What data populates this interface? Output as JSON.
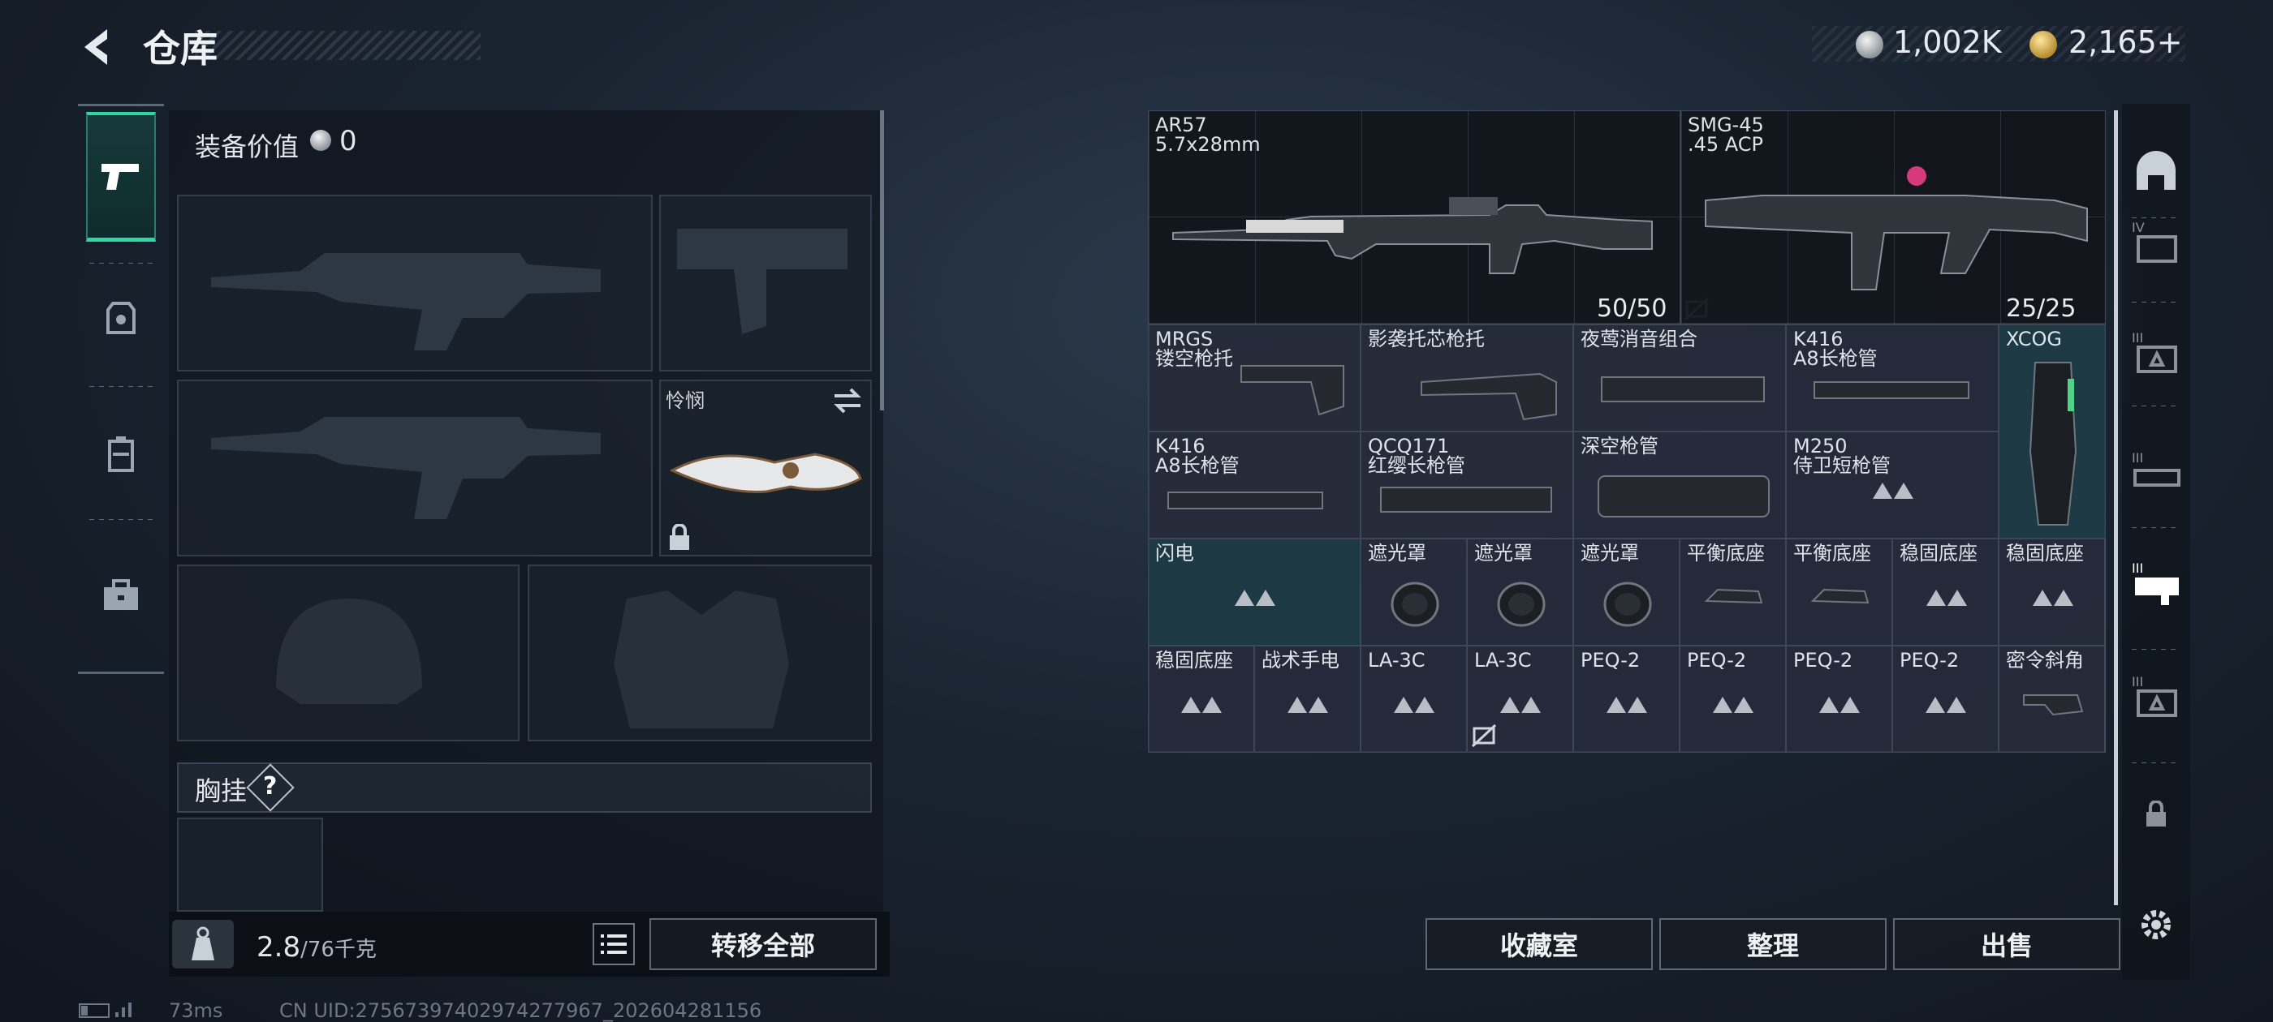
{
  "header": {
    "title": "仓库",
    "silver_amount": "1,002K",
    "gold_amount": "2,165+"
  },
  "left_nav": [
    {
      "icon": "pistol-icon",
      "active": true
    },
    {
      "icon": "armor-icon",
      "active": false
    },
    {
      "icon": "backpack-icon",
      "active": false
    },
    {
      "icon": "toolbox-icon",
      "active": false
    }
  ],
  "loadout": {
    "equipment_value_label": "装备价值",
    "equipment_value": "0",
    "melee_name": "怜悯",
    "chest_rig_label": "胸挂",
    "help_glyph": "?",
    "weight": "2.8",
    "weight_max": "/76千克",
    "transfer_all": "转移全部"
  },
  "inventory": {
    "guns": [
      {
        "name": "AR57",
        "ammo_type": "5.7x28mm",
        "ammo": "50/50"
      },
      {
        "name": "SMG-45",
        "ammo_type": ".45 ACP",
        "ammo": "25/25"
      }
    ],
    "row1": [
      {
        "name": "MRGS",
        "sub": "镂空枪托"
      },
      {
        "name": "影袭托芯枪托",
        "sub": ""
      },
      {
        "name": "夜莺消音组合",
        "sub": ""
      },
      {
        "name": "K416",
        "sub": "A8长枪管"
      }
    ],
    "xcog": "XCOG",
    "row2": [
      {
        "name": "K416",
        "sub": "A8长枪管"
      },
      {
        "name": "QCQ171",
        "sub": "红缨长枪管"
      },
      {
        "name": "深空枪管",
        "sub": ""
      },
      {
        "name": "M250",
        "sub": "侍卫短枪管"
      }
    ],
    "row3": [
      "闪电",
      "遮光罩",
      "遮光罩",
      "遮光罩",
      "平衡底座",
      "平衡底座",
      "稳固底座",
      "稳固底座"
    ],
    "row4": [
      "稳固底座",
      "战术手电",
      "LA-3C",
      "LA-3C",
      "PEQ-2",
      "PEQ-2",
      "PEQ-2",
      "PEQ-2",
      "密令斜角"
    ]
  },
  "actions": {
    "collection": "收藏室",
    "sort": "整理",
    "sell": "出售"
  },
  "right_nav": [
    "helmet-slot-icon",
    "tier-iv-attachment-icon",
    "tier-iii-attachment-icon",
    "tier-iii-barrel-icon",
    "tier-iii-selected-icon",
    "tier-iii-grip-icon",
    "lock-icon"
  ],
  "footer": {
    "ping": "73ms",
    "uid": "CN UID:27567397402974277967_202604281156"
  },
  "colors": {
    "accent_teal": "#2fd6a6",
    "cell_bg": "#2c3042",
    "cell_teal": "#1e3e4a"
  }
}
